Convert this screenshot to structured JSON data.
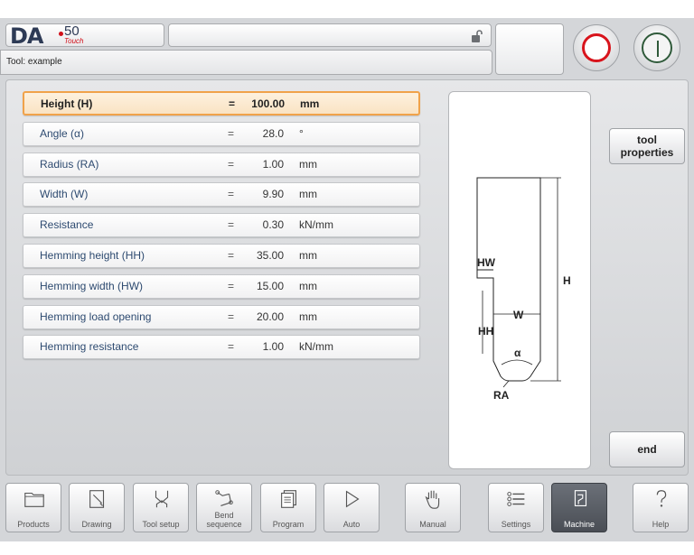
{
  "header": {
    "logo": {
      "brand": "DA",
      "model": "50",
      "sub": "Touch"
    },
    "subtitle": "Tool: example"
  },
  "parameters": [
    {
      "name": "Height (H)",
      "eq": "=",
      "value": "100.00",
      "unit": "mm",
      "selected": true
    },
    {
      "name": "Angle (α)",
      "eq": "=",
      "value": "28.0",
      "unit": "°"
    },
    {
      "name": "Radius (RA)",
      "eq": "=",
      "value": "1.00",
      "unit": "mm"
    },
    {
      "name": "Width (W)",
      "eq": "=",
      "value": "9.90",
      "unit": "mm"
    },
    {
      "name": "Resistance",
      "eq": "=",
      "value": "0.30",
      "unit": "kN/mm"
    },
    {
      "name": "Hemming height (HH)",
      "eq": "=",
      "value": "35.00",
      "unit": "mm"
    },
    {
      "name": "Hemming width (HW)",
      "eq": "=",
      "value": "15.00",
      "unit": "mm"
    },
    {
      "name": "Hemming load opening",
      "eq": "=",
      "value": "20.00",
      "unit": "mm"
    },
    {
      "name": "Hemming resistance",
      "eq": "=",
      "value": "1.00",
      "unit": "kN/mm"
    }
  ],
  "drawing": {
    "labels": {
      "hw": "HW",
      "h": "H",
      "w": "W",
      "hh": "HH",
      "alpha": "α",
      "ra": "RA"
    }
  },
  "side_buttons": {
    "tool_properties": "tool\nproperties",
    "end": "end"
  },
  "nav": [
    {
      "label": "Products",
      "icon": "folder-icon"
    },
    {
      "label": "Drawing",
      "icon": "drawing-icon"
    },
    {
      "label": "Tool setup",
      "icon": "tool-setup-icon"
    },
    {
      "label": "Bend sequence",
      "icon": "bend-sequence-icon"
    },
    {
      "label": "Program",
      "icon": "program-icon"
    },
    {
      "label": "Auto",
      "icon": "play-icon"
    },
    {
      "label": "Manual",
      "icon": "hand-icon"
    },
    {
      "label": "Settings",
      "icon": "settings-icon"
    },
    {
      "label": "Machine",
      "icon": "machine-icon",
      "active": true
    },
    {
      "label": "Help",
      "icon": "help-icon"
    }
  ],
  "colors": {
    "stop": "#d8141c",
    "start": "#2f5a3a",
    "selected_border": "#f0a24a"
  }
}
